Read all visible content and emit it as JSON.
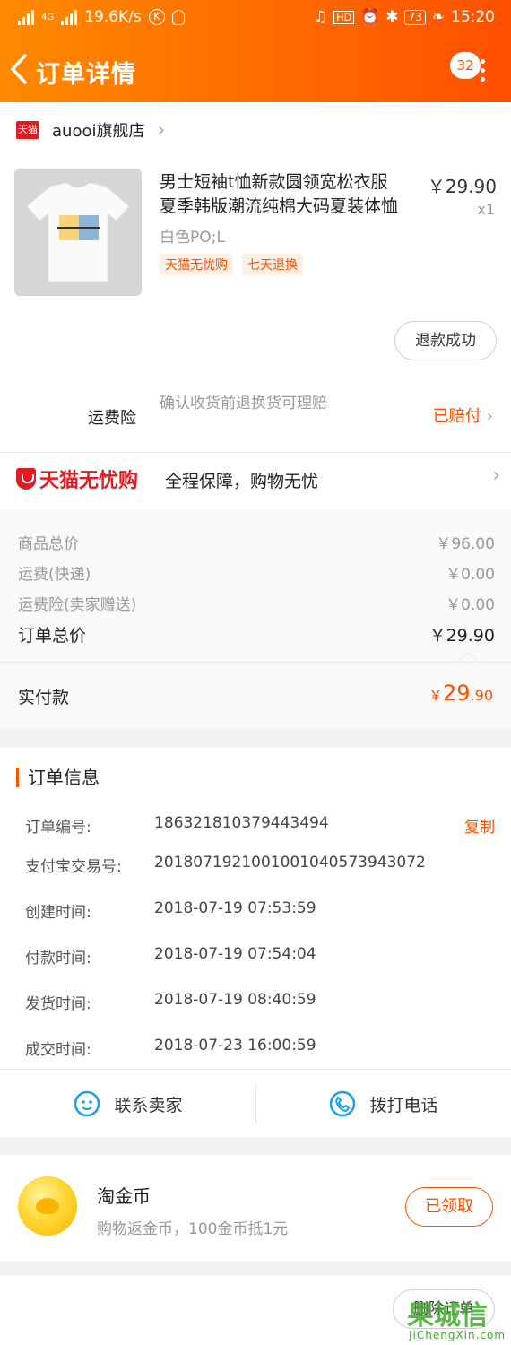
{
  "status_bar": {
    "network": "4G",
    "speed": "19.6K/s",
    "battery": "73",
    "time": "15:20"
  },
  "header": {
    "title": "订单详情",
    "badge": "32",
    "back_icon": "chevron-left-icon",
    "more_icon": "more-vertical-icon"
  },
  "shop": {
    "badge_text": "天猫",
    "name": "auooi旗舰店"
  },
  "product": {
    "title_line1": "男士短袖t恤新款圆领宽松衣服",
    "title_line2": "夏季韩版潮流纯棉大码夏装体恤",
    "price": "￥29.90",
    "quantity": "x1",
    "sku": "白色PO;L",
    "tags": [
      "天猫无忧购",
      "七天退换"
    ],
    "refund_button": "退款成功"
  },
  "insurance": {
    "label": "运费险",
    "description": "确认收货前退换货可理赔",
    "status": "已赔付"
  },
  "guarantee": {
    "logo": "天猫无忧购",
    "text": "全程保障，购物无忧"
  },
  "pricing": {
    "rows": [
      {
        "label": "商品总价",
        "value": "￥96.00"
      },
      {
        "label": "运费(快递)",
        "value": "￥0.00"
      },
      {
        "label": "运费险(卖家赠送)",
        "value": "￥0.00"
      }
    ],
    "total_label": "订单总价",
    "total_value": "￥29.90",
    "paid_label": "实付款",
    "paid_currency": "￥",
    "paid_int": "29",
    "paid_dec": ".90"
  },
  "order_info": {
    "heading": "订单信息",
    "copy_label": "复制",
    "rows": [
      {
        "label": "订单编号:",
        "value": "186321810379443494"
      },
      {
        "label": "支付宝交易号:",
        "value": "2018071921001001040573943072"
      },
      {
        "label": "创建时间:",
        "value": "2018-07-19 07:53:59"
      },
      {
        "label": "付款时间:",
        "value": "2018-07-19 07:54:04"
      },
      {
        "label": "发货时间:",
        "value": "2018-07-19 08:40:59"
      },
      {
        "label": "成交时间:",
        "value": "2018-07-23 16:00:59"
      }
    ]
  },
  "actions": {
    "contact_seller": "联系卖家",
    "call_phone": "拨打电话"
  },
  "coins": {
    "title": "淘金币",
    "subtitle": "购物返金币，100金币抵1元",
    "button": "已领取"
  },
  "bottom": {
    "delete_button": "删除订单",
    "watermark_mark": "果城信",
    "watermark_url": "JiChengXin.com"
  },
  "colors": {
    "accent": "#ff5000",
    "header_start": "#ff8a00",
    "tmall_red": "#e21b23"
  }
}
